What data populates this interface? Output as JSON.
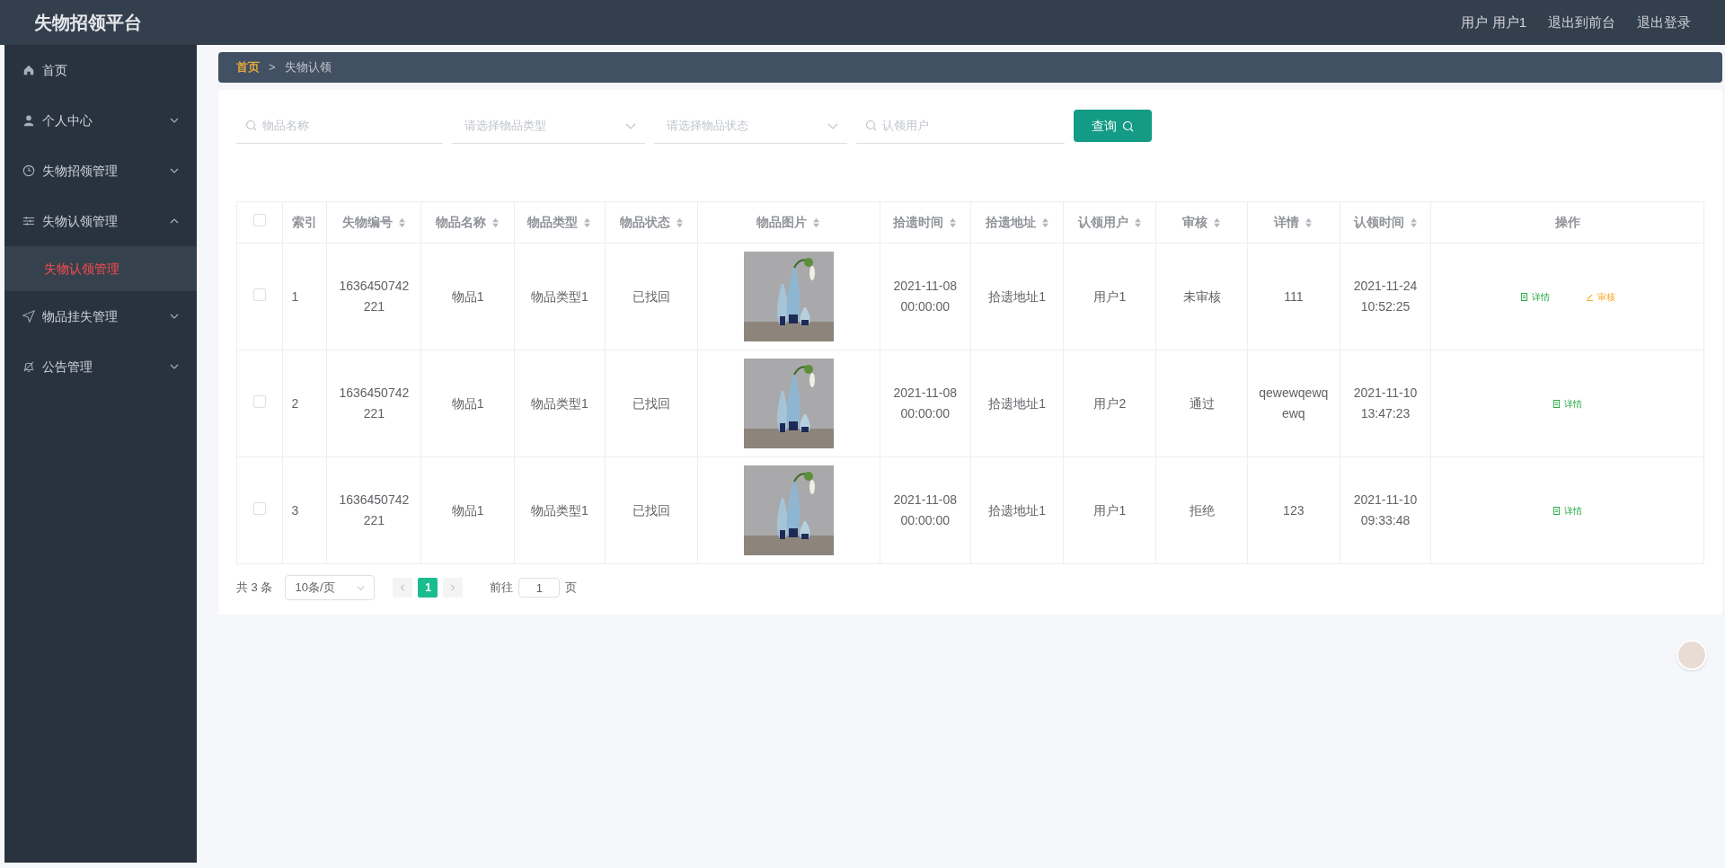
{
  "header": {
    "title": "失物招领平台",
    "links": [
      "用户 用户1",
      "退出到前台",
      "退出登录"
    ]
  },
  "sidebar": {
    "items": [
      {
        "label": "首页",
        "selected": false
      },
      {
        "label": "个人中心",
        "expanded": false,
        "selected": false
      },
      {
        "label": "失物招领管理",
        "expanded": false,
        "selected": false
      },
      {
        "label": "失物认领管理",
        "expanded": true,
        "selected": false,
        "children": [
          {
            "label": "失物认领管理",
            "selected": true
          }
        ]
      },
      {
        "label": "物品挂失管理",
        "expanded": false,
        "selected": false
      },
      {
        "label": "公告管理",
        "expanded": false,
        "selected": false
      }
    ]
  },
  "breadcrumb": {
    "separator": ">",
    "items": [
      "首页",
      "失物认领"
    ]
  },
  "filters": [
    {
      "kind": "search",
      "placeholder": "物品名称"
    },
    {
      "kind": "select",
      "placeholder": "请选择物品类型"
    },
    {
      "kind": "select",
      "placeholder": "请选择物品状态"
    },
    {
      "kind": "search",
      "placeholder": "认领用户"
    }
  ],
  "query_button": "查询",
  "table": {
    "select_all_checked": false,
    "columns": [
      {
        "label": "索引",
        "sortable": false
      },
      {
        "label": "失物编号",
        "sortable": true
      },
      {
        "label": "物品名称",
        "sortable": true
      },
      {
        "label": "物品类型",
        "sortable": true
      },
      {
        "label": "物品状态",
        "sortable": true
      },
      {
        "label": "物品图片",
        "sortable": true
      },
      {
        "label": "拾遗时间",
        "sortable": true
      },
      {
        "label": "拾遗地址",
        "sortable": true
      },
      {
        "label": "认领用户",
        "sortable": true
      },
      {
        "label": "审核",
        "sortable": true
      },
      {
        "label": "详情",
        "sortable": true
      },
      {
        "label": "认领时间",
        "sortable": true
      },
      {
        "label": "操作",
        "sortable": false
      }
    ],
    "rows": [
      {
        "checked": false,
        "cells": [
          "1",
          "1636450742221",
          "物品1",
          "物品类型1",
          "已找回",
          {
            "kind": "picture"
          },
          "2021-11-08 00:00:00",
          "拾遗地址1",
          "用户1",
          "未审核",
          "111",
          "2021-11-24 10:52:25"
        ],
        "actions": [
          {
            "kind": "detail",
            "label": "详情"
          },
          {
            "kind": "review",
            "label": "审核"
          }
        ]
      },
      {
        "checked": false,
        "cells": [
          "2",
          "1636450742221",
          "物品1",
          "物品类型1",
          "已找回",
          {
            "kind": "picture"
          },
          "2021-11-08 00:00:00",
          "拾遗地址1",
          "用户2",
          "通过",
          "qewewqewqewq",
          "2021-11-10 13:47:23"
        ],
        "actions": [
          {
            "kind": "detail",
            "label": "详情"
          }
        ]
      },
      {
        "checked": false,
        "cells": [
          "3",
          "1636450742221",
          "物品1",
          "物品类型1",
          "已找回",
          {
            "kind": "picture"
          },
          "2021-11-08 00:00:00",
          "拾遗地址1",
          "用户1",
          "拒绝",
          "123",
          "2021-11-10 09:33:48"
        ],
        "actions": [
          {
            "kind": "detail",
            "label": "详情"
          }
        ]
      }
    ]
  },
  "pagination": {
    "total": "共 3 条",
    "page_size": "10条/页",
    "pages": [
      {
        "label": "1",
        "selected": true
      }
    ],
    "goto_label": "前往",
    "goto_value": "1",
    "goto_suffix": "页"
  }
}
